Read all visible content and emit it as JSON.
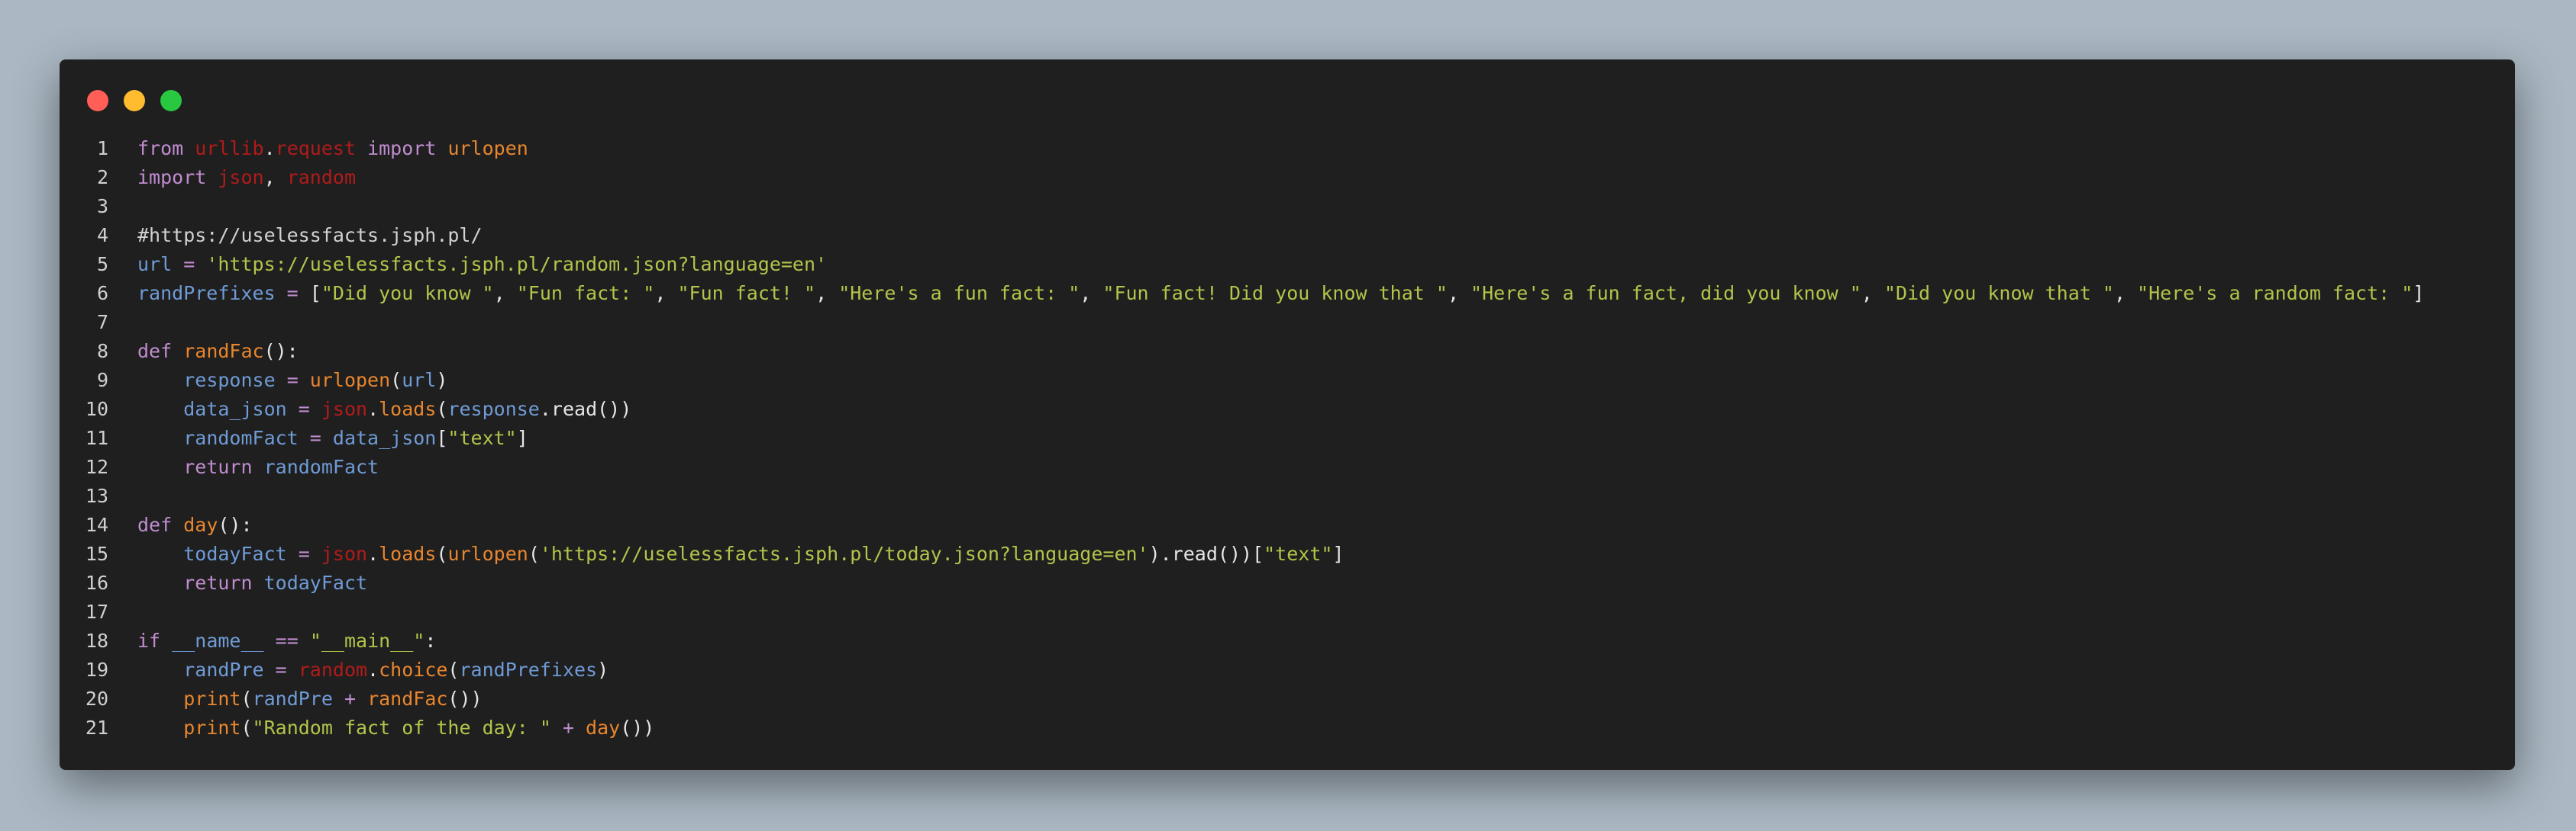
{
  "window": {
    "buttons": {
      "close_color": "#ff5f57",
      "minimize_color": "#febc2e",
      "zoom_color": "#28c840"
    }
  },
  "code": {
    "language": "python",
    "lines": [
      {
        "num": "1",
        "tokens": [
          {
            "t": "from",
            "c": "kw"
          },
          {
            "t": " ",
            "c": "pun"
          },
          {
            "t": "urllib",
            "c": "mod"
          },
          {
            "t": ".",
            "c": "pun"
          },
          {
            "t": "request",
            "c": "mod"
          },
          {
            "t": " ",
            "c": "pun"
          },
          {
            "t": "import",
            "c": "kw"
          },
          {
            "t": " ",
            "c": "pun"
          },
          {
            "t": "urlopen",
            "c": "fn"
          }
        ]
      },
      {
        "num": "2",
        "tokens": [
          {
            "t": "import",
            "c": "kw"
          },
          {
            "t": " ",
            "c": "pun"
          },
          {
            "t": "json",
            "c": "mod"
          },
          {
            "t": ", ",
            "c": "pun"
          },
          {
            "t": "random",
            "c": "mod"
          }
        ]
      },
      {
        "num": "3",
        "tokens": []
      },
      {
        "num": "4",
        "tokens": [
          {
            "t": "#https://uselessfacts.jsph.pl/",
            "c": "com"
          }
        ]
      },
      {
        "num": "5",
        "tokens": [
          {
            "t": "url",
            "c": "var"
          },
          {
            "t": " = ",
            "c": "op"
          },
          {
            "t": "'https://uselessfacts.jsph.pl/random.json?language=en'",
            "c": "str"
          }
        ]
      },
      {
        "num": "6",
        "tokens": [
          {
            "t": "randPrefixes",
            "c": "var"
          },
          {
            "t": " = ",
            "c": "op"
          },
          {
            "t": "[",
            "c": "pun"
          },
          {
            "t": "\"Did you know \"",
            "c": "str"
          },
          {
            "t": ", ",
            "c": "pun"
          },
          {
            "t": "\"Fun fact: \"",
            "c": "str"
          },
          {
            "t": ", ",
            "c": "pun"
          },
          {
            "t": "\"Fun fact! \"",
            "c": "str"
          },
          {
            "t": ", ",
            "c": "pun"
          },
          {
            "t": "\"Here's a fun fact: \"",
            "c": "str"
          },
          {
            "t": ", ",
            "c": "pun"
          },
          {
            "t": "\"Fun fact! Did you know that \"",
            "c": "str"
          },
          {
            "t": ", ",
            "c": "pun"
          },
          {
            "t": "\"Here's a fun fact, did you know \"",
            "c": "str"
          },
          {
            "t": ", ",
            "c": "pun"
          },
          {
            "t": "\"Did you know that \"",
            "c": "str"
          },
          {
            "t": ", ",
            "c": "pun"
          },
          {
            "t": "\"Here's a random fact: \"",
            "c": "str"
          },
          {
            "t": "]",
            "c": "pun"
          }
        ]
      },
      {
        "num": "7",
        "tokens": []
      },
      {
        "num": "8",
        "tokens": [
          {
            "t": "def",
            "c": "kw"
          },
          {
            "t": " ",
            "c": "pun"
          },
          {
            "t": "randFac",
            "c": "fn"
          },
          {
            "t": "():",
            "c": "pun"
          }
        ]
      },
      {
        "num": "9",
        "tokens": [
          {
            "t": "    ",
            "c": "pun"
          },
          {
            "t": "response",
            "c": "var"
          },
          {
            "t": " = ",
            "c": "op"
          },
          {
            "t": "urlopen",
            "c": "fn"
          },
          {
            "t": "(",
            "c": "pun"
          },
          {
            "t": "url",
            "c": "var"
          },
          {
            "t": ")",
            "c": "pun"
          }
        ]
      },
      {
        "num": "10",
        "tokens": [
          {
            "t": "    ",
            "c": "pun"
          },
          {
            "t": "data_json",
            "c": "var"
          },
          {
            "t": " = ",
            "c": "op"
          },
          {
            "t": "json",
            "c": "mod"
          },
          {
            "t": ".",
            "c": "pun"
          },
          {
            "t": "loads",
            "c": "fn"
          },
          {
            "t": "(",
            "c": "pun"
          },
          {
            "t": "response",
            "c": "var"
          },
          {
            "t": ".read())",
            "c": "pun"
          }
        ]
      },
      {
        "num": "11",
        "tokens": [
          {
            "t": "    ",
            "c": "pun"
          },
          {
            "t": "randomFact",
            "c": "var"
          },
          {
            "t": " = ",
            "c": "op"
          },
          {
            "t": "data_json",
            "c": "var"
          },
          {
            "t": "[",
            "c": "pun"
          },
          {
            "t": "\"text\"",
            "c": "str"
          },
          {
            "t": "]",
            "c": "pun"
          }
        ]
      },
      {
        "num": "12",
        "tokens": [
          {
            "t": "    ",
            "c": "pun"
          },
          {
            "t": "return",
            "c": "kw"
          },
          {
            "t": " ",
            "c": "pun"
          },
          {
            "t": "randomFact",
            "c": "var"
          }
        ]
      },
      {
        "num": "13",
        "tokens": []
      },
      {
        "num": "14",
        "tokens": [
          {
            "t": "def",
            "c": "kw"
          },
          {
            "t": " ",
            "c": "pun"
          },
          {
            "t": "day",
            "c": "fn"
          },
          {
            "t": "():",
            "c": "pun"
          }
        ]
      },
      {
        "num": "15",
        "tokens": [
          {
            "t": "    ",
            "c": "pun"
          },
          {
            "t": "todayFact",
            "c": "var"
          },
          {
            "t": " = ",
            "c": "op"
          },
          {
            "t": "json",
            "c": "mod"
          },
          {
            "t": ".",
            "c": "pun"
          },
          {
            "t": "loads",
            "c": "fn"
          },
          {
            "t": "(",
            "c": "pun"
          },
          {
            "t": "urlopen",
            "c": "fn"
          },
          {
            "t": "(",
            "c": "pun"
          },
          {
            "t": "'https://uselessfacts.jsph.pl/today.json?language=en'",
            "c": "str"
          },
          {
            "t": ").read())[",
            "c": "pun"
          },
          {
            "t": "\"text\"",
            "c": "str"
          },
          {
            "t": "]",
            "c": "pun"
          }
        ]
      },
      {
        "num": "16",
        "tokens": [
          {
            "t": "    ",
            "c": "pun"
          },
          {
            "t": "return",
            "c": "kw"
          },
          {
            "t": " ",
            "c": "pun"
          },
          {
            "t": "todayFact",
            "c": "var"
          }
        ]
      },
      {
        "num": "17",
        "tokens": []
      },
      {
        "num": "18",
        "tokens": [
          {
            "t": "if",
            "c": "kw"
          },
          {
            "t": " ",
            "c": "pun"
          },
          {
            "t": "__name__",
            "c": "var"
          },
          {
            "t": " == ",
            "c": "op"
          },
          {
            "t": "\"__main__\"",
            "c": "str"
          },
          {
            "t": ":",
            "c": "pun"
          }
        ]
      },
      {
        "num": "19",
        "tokens": [
          {
            "t": "    ",
            "c": "pun"
          },
          {
            "t": "randPre",
            "c": "var"
          },
          {
            "t": " = ",
            "c": "op"
          },
          {
            "t": "random",
            "c": "mod"
          },
          {
            "t": ".",
            "c": "pun"
          },
          {
            "t": "choice",
            "c": "fn"
          },
          {
            "t": "(",
            "c": "pun"
          },
          {
            "t": "randPrefixes",
            "c": "var"
          },
          {
            "t": ")",
            "c": "pun"
          }
        ]
      },
      {
        "num": "20",
        "tokens": [
          {
            "t": "    ",
            "c": "pun"
          },
          {
            "t": "print",
            "c": "fn"
          },
          {
            "t": "(",
            "c": "pun"
          },
          {
            "t": "randPre",
            "c": "var"
          },
          {
            "t": " + ",
            "c": "op"
          },
          {
            "t": "randFac",
            "c": "fn"
          },
          {
            "t": "())",
            "c": "pun"
          }
        ]
      },
      {
        "num": "21",
        "tokens": [
          {
            "t": "    ",
            "c": "pun"
          },
          {
            "t": "print",
            "c": "fn"
          },
          {
            "t": "(",
            "c": "pun"
          },
          {
            "t": "\"Random fact of the day: \"",
            "c": "str"
          },
          {
            "t": " + ",
            "c": "op"
          },
          {
            "t": "day",
            "c": "fn"
          },
          {
            "t": "())",
            "c": "pun"
          }
        ]
      }
    ]
  }
}
